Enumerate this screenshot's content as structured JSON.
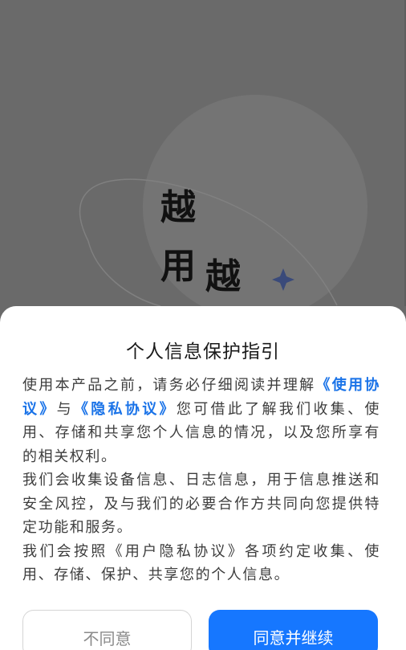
{
  "splash": {
    "slogan_chars": [
      "越",
      "用",
      "越"
    ]
  },
  "dialog": {
    "title": "个人信息保护指引",
    "paragraph1_before": "使用本产品之前，请务必仔细阅读并理解",
    "user_agreement_link": "《使用协议》",
    "paragraph1_and": "与",
    "privacy_agreement_link": "《隐私协议》",
    "paragraph1_after": "您可借此了解我们收集、使用、存储和共享您个人信息的情况，以及您所享有的相关权利。",
    "paragraph2": "我们会收集设备信息、日志信息，用于信息推送和安全风控，及与我们的必要合作方共同向您提供特定功能和服务。",
    "paragraph3": "我们会按照《用户隐私协议》各项约定收集、使用、存储、保护、共享您的个人信息。",
    "decline_label": "不同意",
    "accept_label": "同意并继续"
  },
  "colors": {
    "link": "#1a73e8",
    "accept_button": "#1677ff",
    "backdrop": "#6a6a6a"
  }
}
